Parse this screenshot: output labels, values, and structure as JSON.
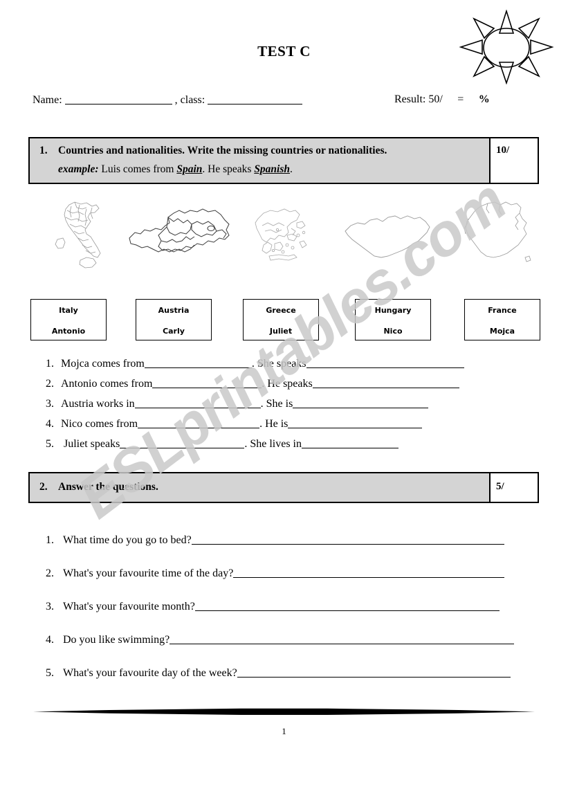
{
  "page": {
    "title": "TEST C",
    "page_number": "1",
    "watermark": "ESLprintables.com"
  },
  "header": {
    "name_label": "Name:",
    "class_label": ", class:",
    "result_label": "Result: 50/",
    "equals": "=",
    "percent": "%"
  },
  "task1": {
    "number": "1.",
    "instruction": "Countries and nationalities. Write the missing countries or nationalities.",
    "example_label": "example:",
    "example_pre": " Luis comes from ",
    "example_country": "Spain",
    "example_mid": ". He speaks ",
    "example_nationality": "Spanish",
    "example_end": ".",
    "score": "10/"
  },
  "task2": {
    "number": "2.",
    "instruction": "Answer the questions.",
    "score": "5/"
  },
  "country_boxes": [
    {
      "country": "Italy",
      "person": "Antonio"
    },
    {
      "country": "Austria",
      "person": "Carly"
    },
    {
      "country": "Greece",
      "person": "Juliet"
    },
    {
      "country": "Hungary",
      "person": "Nico"
    },
    {
      "country": "France",
      "person": "Mojca"
    }
  ],
  "maps": [
    {
      "name": "italy-map"
    },
    {
      "name": "austria-map"
    },
    {
      "name": "greece-map"
    },
    {
      "name": "hungary-map"
    },
    {
      "name": "france-map"
    }
  ],
  "fill_sentences": [
    {
      "index": "1.",
      "part1": "Mojca comes from",
      "part2": ". She speaks"
    },
    {
      "index": "2.",
      "part1": "Antonio comes from",
      "part2": ". He speaks"
    },
    {
      "index": "3.",
      "part1": "Austria works in",
      "part2": ". She is"
    },
    {
      "index": "4.",
      "part1": "Nico comes from",
      "part2": ". He is"
    },
    {
      "index": "5.",
      "part1": " Juliet speaks",
      "part2": ". She lives in"
    }
  ],
  "questions": [
    {
      "index": "1.",
      "text": "What time do you go to bed?"
    },
    {
      "index": "2.",
      "text": "What's your favourite time of the day?"
    },
    {
      "index": "3.",
      "text": "What's your favourite month?"
    },
    {
      "index": "4.",
      "text": "Do you like swimming?"
    },
    {
      "index": "5.",
      "text": "What's your favourite day of the week?"
    }
  ],
  "colors": {
    "banner_fill": "#d4d4d4",
    "ink": "#000000",
    "watermark": "#c9c9c9",
    "map_line": "#9a9a9a"
  }
}
